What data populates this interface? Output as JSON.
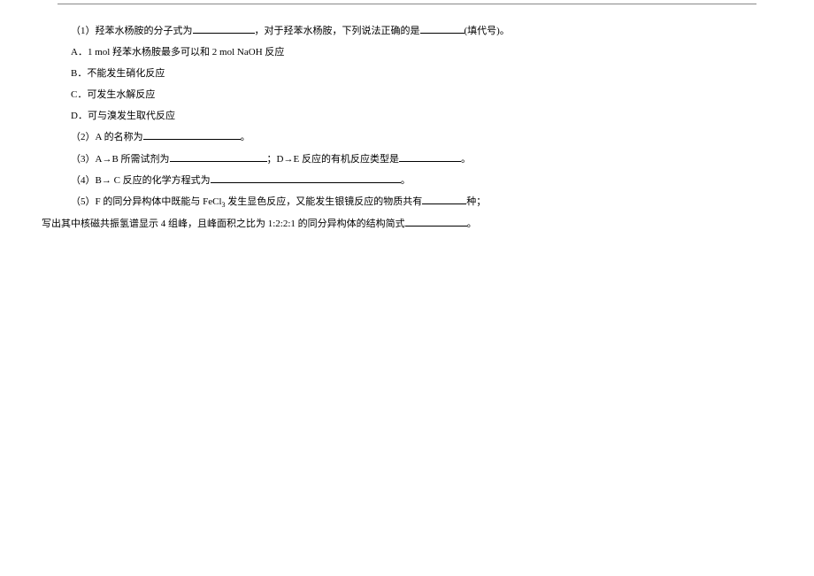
{
  "q1": {
    "prefix": "（1）羟苯水杨胺的分子式为",
    "mid": "，对于羟苯水杨胺，下列说法正确的是",
    "suffix": "(填代号)。"
  },
  "options": {
    "A": "A．1 mol 羟苯水杨胺最多可以和 2 mol NaOH 反应",
    "B": "B．不能发生硝化反应",
    "C": "C．可发生水解反应",
    "D": "D．可与溴发生取代反应"
  },
  "q2": {
    "prefix": "（2）A 的名称为",
    "suffix": "。"
  },
  "q3": {
    "prefix": "（3）A→B 所需试剂为",
    "mid": "；D→E 反应的有机反应类型是",
    "suffix": "。"
  },
  "q4": {
    "prefix": "（4）B→ C 反应的化学方程式为",
    "suffix": "。"
  },
  "q5": {
    "prefix": "（5）F 的同分异构体中既能与 FeCl",
    "sub3": "3",
    "mid": " 发生显色反应，又能发生银镜反应的物质共有",
    "suffix": "种；"
  },
  "q5b": {
    "prefix": "写出其中核磁共振氢谱显示 4 组峰，且峰面积之比为 1:2:2:1 的同分异构体的结构简式",
    "suffix": "。"
  }
}
